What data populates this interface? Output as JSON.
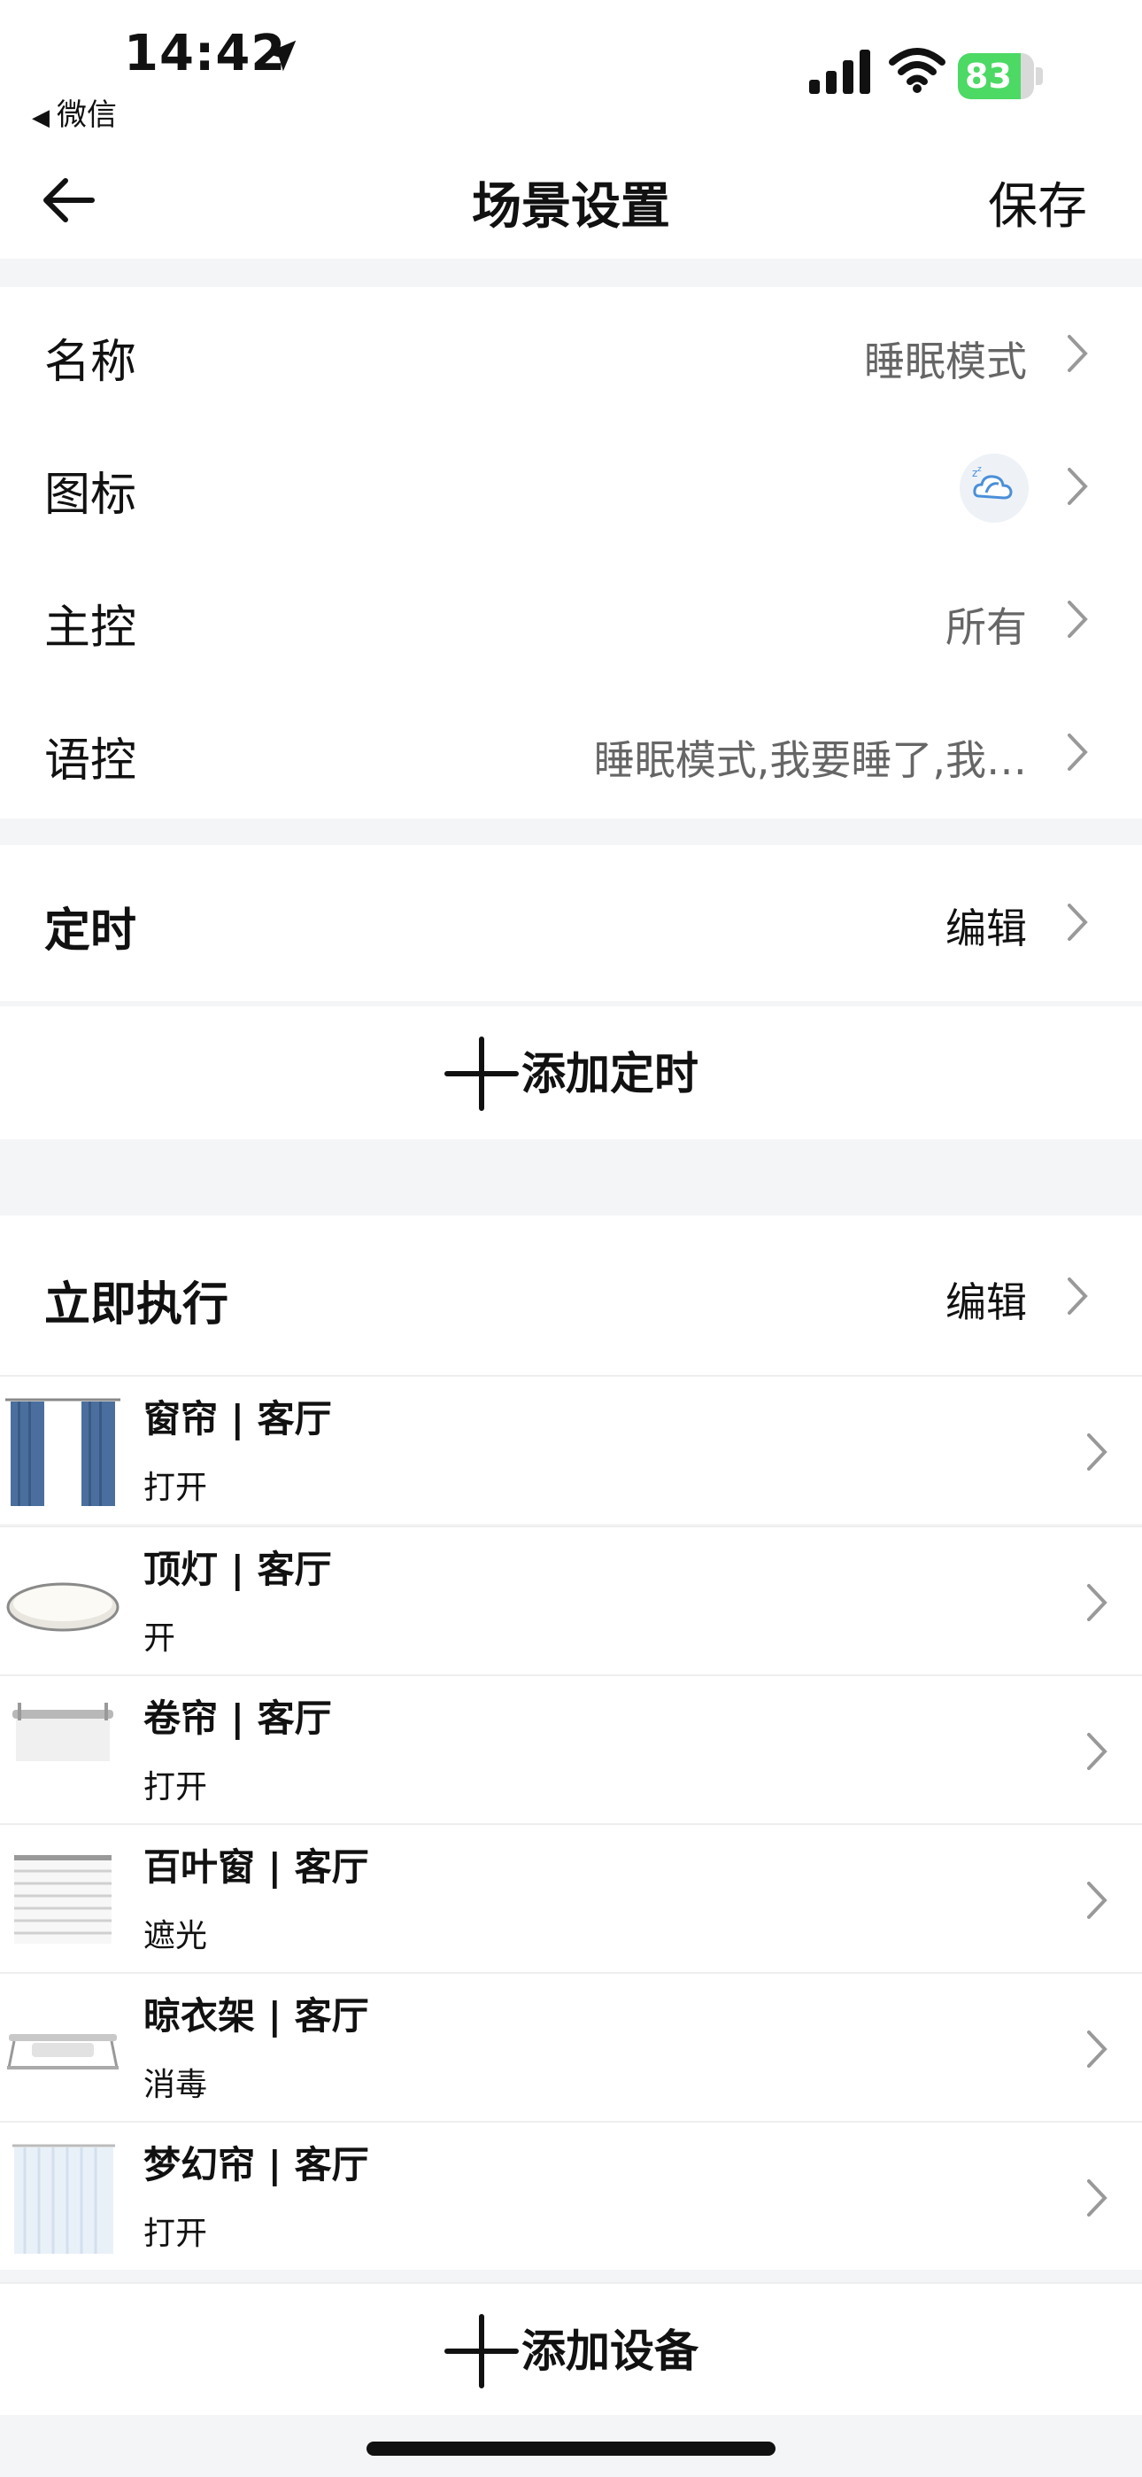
{
  "status_bar": {
    "time": "14:42",
    "back_app": "微信",
    "battery": "83",
    "battery_level": 0.83
  },
  "nav": {
    "title": "场景设置",
    "save": "保存"
  },
  "settings": {
    "name_label": "名称",
    "name_value": "睡眠模式",
    "icon_label": "图标",
    "main_label": "主控",
    "main_value": "所有",
    "voice_label": "语控",
    "voice_value": "睡眠模式,我要睡了,我…"
  },
  "timer": {
    "title": "定时",
    "edit": "编辑",
    "add": "添加定时"
  },
  "execute": {
    "title": "立即执行",
    "edit": "编辑",
    "add": "添加设备",
    "devices": [
      {
        "name": "窗帘 | 客厅",
        "state": "打开",
        "image": "curtain"
      },
      {
        "name": "顶灯 | 客厅",
        "state": "开",
        "image": "ceiling-light"
      },
      {
        "name": "卷帘 | 客厅",
        "state": "打开",
        "image": "roller-blind"
      },
      {
        "name": "百叶窗 | 客厅",
        "state": "遮光",
        "image": "venetian-blind"
      },
      {
        "name": "晾衣架 | 客厅",
        "state": "消毒",
        "image": "clothes-rack"
      },
      {
        "name": "梦幻帘 | 客厅",
        "state": "打开",
        "image": "dream-curtain"
      }
    ]
  },
  "colors": {
    "page_bg": "#f4f5f7",
    "battery_green": "#4cd964",
    "text_secondary": "#666666"
  }
}
